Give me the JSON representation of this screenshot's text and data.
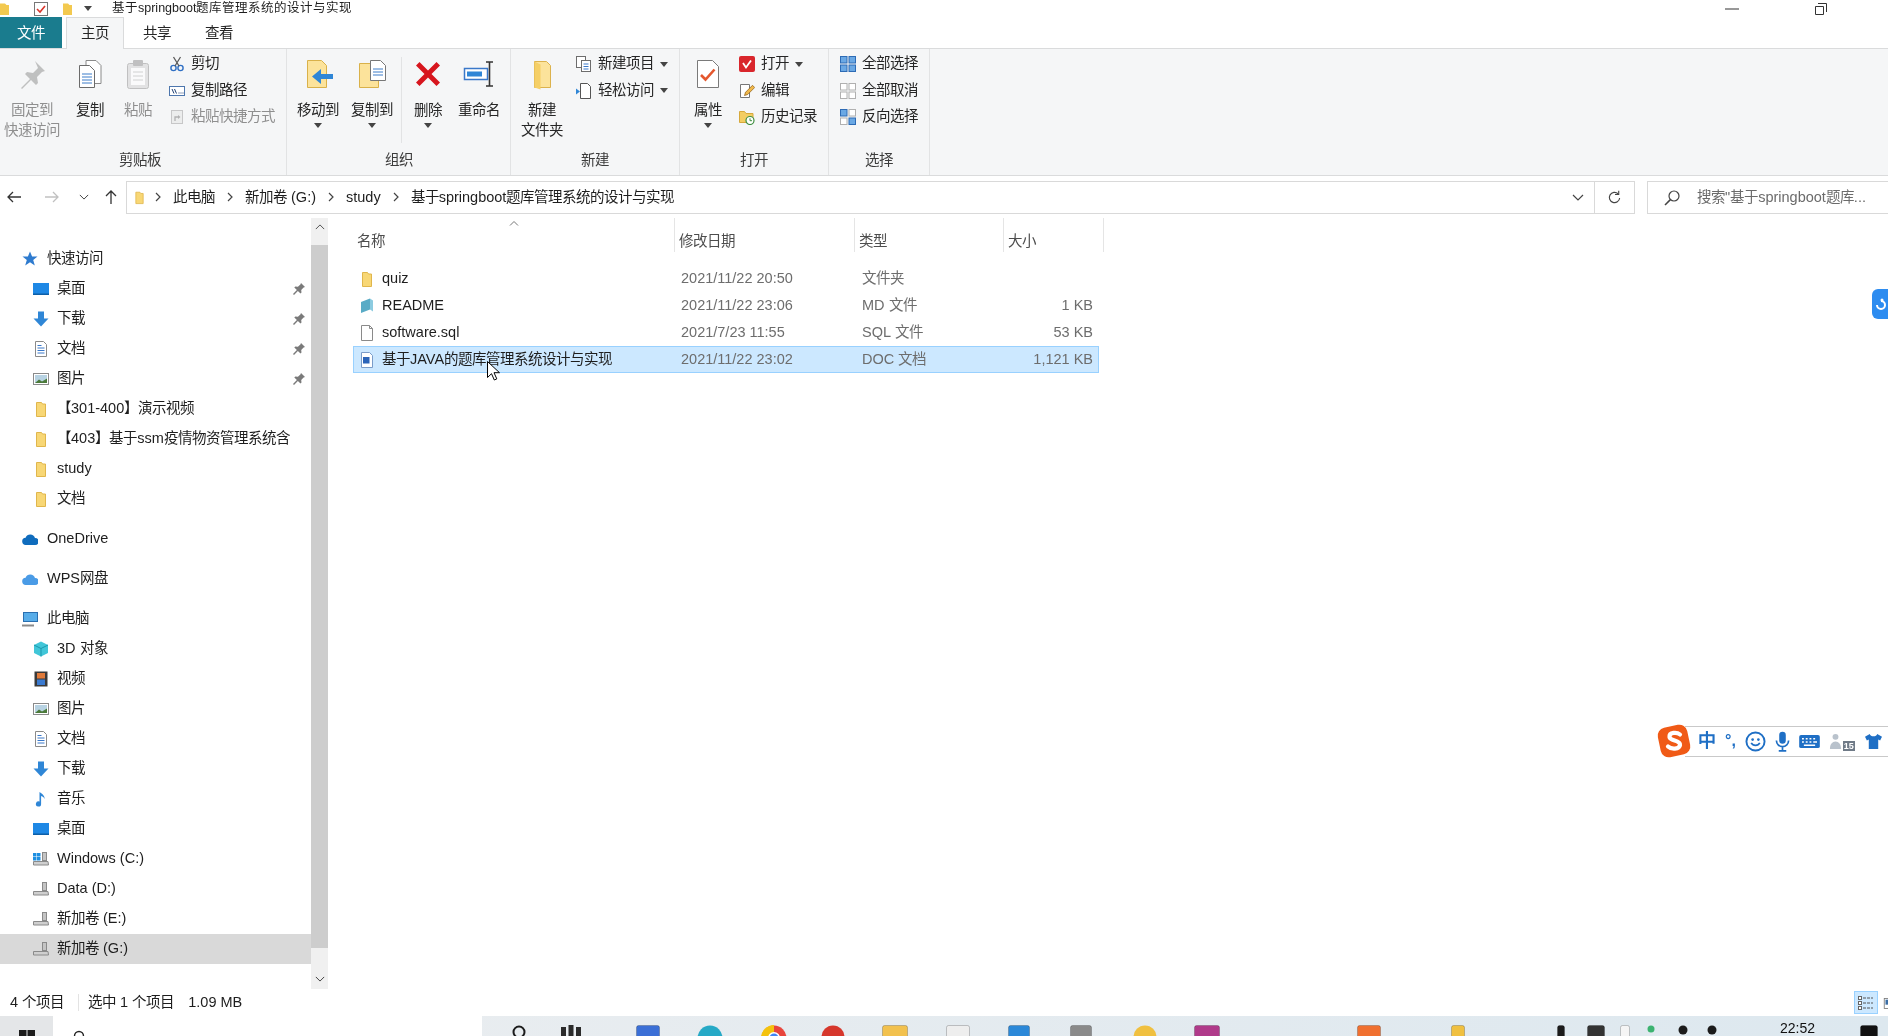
{
  "window": {
    "title": "基于springboot题库管理系统的设计与实现"
  },
  "ribbon_tabs": [
    {
      "label": "文件",
      "kind": "file",
      "selected": false
    },
    {
      "label": "主页",
      "kind": "tab",
      "selected": true
    },
    {
      "label": "共享",
      "kind": "tab",
      "selected": false
    },
    {
      "label": "查看",
      "kind": "tab",
      "selected": false
    }
  ],
  "ribbon_groups": [
    {
      "label": "剪贴板",
      "items": [
        {
          "kind": "large",
          "label_lines": [
            "固定到",
            "快速访问"
          ],
          "disabled": true,
          "dropdown": false
        },
        {
          "kind": "large",
          "label": "复制",
          "disabled": false,
          "dropdown": false
        },
        {
          "kind": "large",
          "label": "粘贴",
          "disabled": true,
          "dropdown": false
        },
        {
          "kind": "small",
          "label": "剪切",
          "disabled": false,
          "dropdown": false
        },
        {
          "kind": "small",
          "label": "复制路径",
          "disabled": false,
          "dropdown": false
        },
        {
          "kind": "small",
          "label": "粘贴快捷方式",
          "disabled": true,
          "dropdown": false
        }
      ]
    },
    {
      "label": "组织",
      "items": [
        {
          "kind": "large",
          "label": "移动到",
          "disabled": false,
          "dropdown": true
        },
        {
          "kind": "large",
          "label": "复制到",
          "disabled": false,
          "dropdown": true
        },
        {
          "kind": "separator"
        },
        {
          "kind": "large",
          "label": "删除",
          "disabled": false,
          "dropdown": true
        },
        {
          "kind": "large",
          "label": "重命名",
          "disabled": false,
          "dropdown": false
        }
      ]
    },
    {
      "label": "新建",
      "items": [
        {
          "kind": "large",
          "label_lines": [
            "新建",
            "文件夹"
          ],
          "disabled": false,
          "dropdown": false
        },
        {
          "kind": "small",
          "label": "新建项目",
          "disabled": false,
          "dropdown": true
        },
        {
          "kind": "small",
          "label": "轻松访问",
          "disabled": false,
          "dropdown": true
        }
      ]
    },
    {
      "label": "打开",
      "items": [
        {
          "kind": "large",
          "label": "属性",
          "disabled": false,
          "dropdown": true
        },
        {
          "kind": "small",
          "label": "打开",
          "disabled": false,
          "dropdown": true
        },
        {
          "kind": "small",
          "label": "编辑",
          "disabled": false,
          "dropdown": false
        },
        {
          "kind": "small",
          "label": "历史记录",
          "disabled": false,
          "dropdown": false
        }
      ]
    },
    {
      "label": "选择",
      "items": [
        {
          "kind": "small",
          "label": "全部选择",
          "disabled": false,
          "dropdown": false
        },
        {
          "kind": "small",
          "label": "全部取消",
          "disabled": false,
          "dropdown": false
        },
        {
          "kind": "small",
          "label": "反向选择",
          "disabled": false,
          "dropdown": false
        }
      ]
    }
  ],
  "nav_buttons": [
    {
      "kind": "back",
      "disabled": false
    },
    {
      "kind": "forward",
      "disabled": true
    },
    {
      "kind": "recent",
      "disabled": false
    },
    {
      "kind": "up",
      "disabled": false
    }
  ],
  "address": {
    "path": [
      "此电脑",
      "新加卷 (G:)",
      "study",
      "基于springboot题库管理系统的设计与实现"
    ]
  },
  "search": {
    "placeholder": "搜索\"基于springboot题库..."
  },
  "sidebar": {
    "items": [
      {
        "label": "快速访问",
        "kind": "quick_access",
        "selected": false,
        "children": [
          {
            "label": "桌面",
            "kind": "desktop",
            "pinned": true,
            "selected": false
          },
          {
            "label": "下载",
            "kind": "downloads",
            "pinned": true,
            "selected": false
          },
          {
            "label": "文档",
            "kind": "documents",
            "pinned": true,
            "selected": false
          },
          {
            "label": "图片",
            "kind": "pictures",
            "pinned": true,
            "selected": false
          },
          {
            "label": "【301-400】演示视频",
            "kind": "folder",
            "pinned": false,
            "selected": false
          },
          {
            "label": "【403】基于ssm疫情物资管理系统含",
            "kind": "folder",
            "pinned": false,
            "selected": false
          },
          {
            "label": "study",
            "kind": "folder",
            "pinned": false,
            "selected": false
          },
          {
            "label": "文档",
            "kind": "folder",
            "pinned": false,
            "selected": false
          }
        ]
      },
      {
        "label": "OneDrive",
        "kind": "onedrive",
        "selected": false
      },
      {
        "label": "WPS网盘",
        "kind": "wps_cloud",
        "selected": false
      },
      {
        "label": "此电脑",
        "kind": "this_pc",
        "selected": false,
        "children": [
          {
            "label": "3D 对象",
            "kind": "objects3d",
            "selected": false
          },
          {
            "label": "视频",
            "kind": "videos",
            "selected": false
          },
          {
            "label": "图片",
            "kind": "pictures",
            "selected": false
          },
          {
            "label": "文档",
            "kind": "documents",
            "selected": false
          },
          {
            "label": "下载",
            "kind": "downloads",
            "selected": false
          },
          {
            "label": "音乐",
            "kind": "music",
            "selected": false
          },
          {
            "label": "桌面",
            "kind": "desktop",
            "selected": false
          },
          {
            "label": "Windows (C:)",
            "kind": "system_drive",
            "selected": false
          },
          {
            "label": "Data (D:)",
            "kind": "drive",
            "selected": false
          },
          {
            "label": "新加卷 (E:)",
            "kind": "drive",
            "selected": false
          },
          {
            "label": "新加卷 (G:)",
            "kind": "drive",
            "selected": true
          }
        ]
      }
    ]
  },
  "file_list": {
    "columns": [
      {
        "label": "名称",
        "sorted": true
      },
      {
        "label": "修改日期",
        "sorted": false
      },
      {
        "label": "类型",
        "sorted": false
      },
      {
        "label": "大小",
        "sorted": false
      }
    ],
    "rows": [
      {
        "kind": "folder",
        "name": "quiz",
        "modified": "2021/11/22 20:50",
        "type": "文件夹",
        "selected": false
      },
      {
        "kind": "markdown",
        "name": "README",
        "modified": "2021/11/22 23:06",
        "type": "MD 文件",
        "size": "1 KB",
        "selected": false
      },
      {
        "kind": "sql",
        "name": "software.sql",
        "modified": "2021/7/23 11:55",
        "type": "SQL 文件",
        "size": "53 KB",
        "selected": false
      },
      {
        "kind": "word",
        "name": "基于JAVA的题库管理系统设计与实现",
        "modified": "2021/11/22 23:02",
        "type": "DOC 文档",
        "size": "1,121 KB",
        "selected": true
      }
    ]
  },
  "status_bar": {
    "item_count": "4 个项目",
    "selection": "选中 1 个项目",
    "selection_size": "1.09 MB",
    "views": [
      {
        "kind": "details",
        "selected": true
      },
      {
        "kind": "large_icons",
        "selected": false
      }
    ]
  },
  "ime_toolbar": {
    "mode": "中",
    "punctuation": "°,",
    "badge": "15"
  },
  "taskbar": {
    "clock": "22:52"
  }
}
